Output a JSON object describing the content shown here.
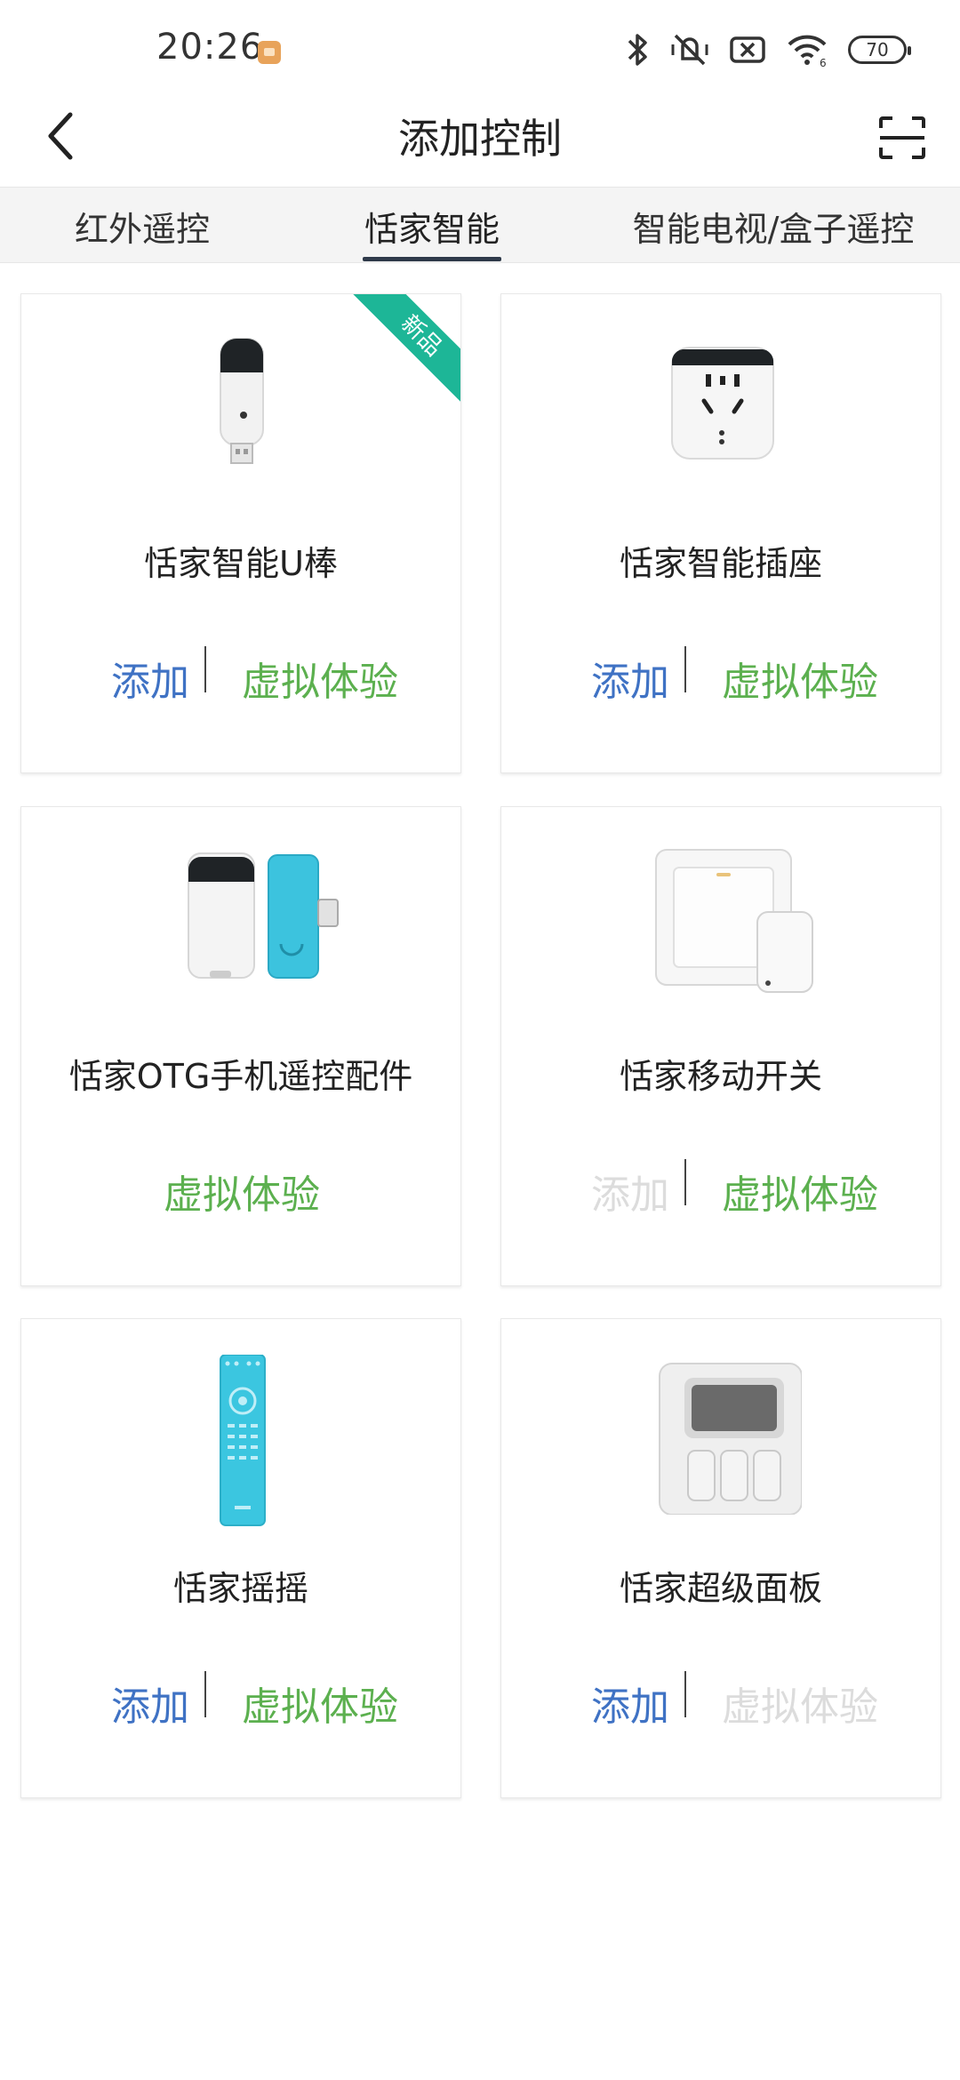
{
  "status_bar": {
    "time": "20:26",
    "battery": "70"
  },
  "header": {
    "title": "添加控制"
  },
  "tabs": [
    {
      "label": "红外遥控"
    },
    {
      "label": "恬家智能"
    },
    {
      "label": "智能电视/盒子遥控"
    }
  ],
  "active_tab": "恬家智能",
  "colors": {
    "add": "#3f72c4",
    "try": "#5cb04f",
    "disabled": "#dcdcdc",
    "ribbon": "#1db697",
    "tab_bg": "#f4f4f4"
  },
  "cards": [
    {
      "name": "恬家智能U棒",
      "badge": "新品",
      "add_label": "添加",
      "try_label": "虚拟体验",
      "icon": "usb-stick-icon"
    },
    {
      "name": "恬家智能插座",
      "add_label": "添加",
      "try_label": "虚拟体验",
      "icon": "smart-plug-icon"
    },
    {
      "name": "恬家OTG手机遥控配件",
      "try_label": "虚拟体验",
      "icon": "otg-adapter-icon"
    },
    {
      "name": "恬家移动开关",
      "add_label": "添加",
      "add_disabled": true,
      "try_label": "虚拟体验",
      "icon": "wall-switch-icon"
    },
    {
      "name": "恬家摇摇",
      "add_label": "添加",
      "try_label": "虚拟体验",
      "icon": "remote-control-icon"
    },
    {
      "name": "恬家超级面板",
      "add_label": "添加",
      "try_label": "虚拟体验",
      "try_disabled": true,
      "icon": "super-panel-icon"
    }
  ]
}
